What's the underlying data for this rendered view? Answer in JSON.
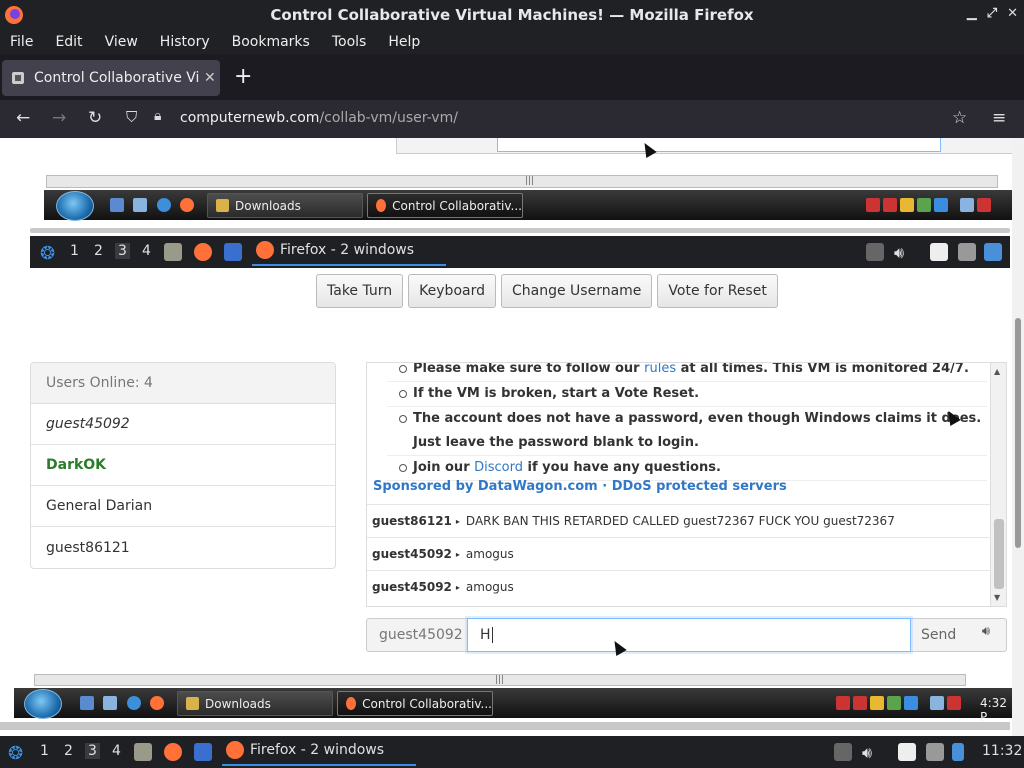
{
  "browser": {
    "window_title": "Control Collaborative Virtual Machines! — Mozilla Firefox",
    "menu": [
      "File",
      "Edit",
      "View",
      "History",
      "Bookmarks",
      "Tools",
      "Help"
    ],
    "tab_title": "Control Collaborative Virtual Machines!",
    "url_domain": "computernewb.com",
    "url_path": "/collab-vm/user-vm/"
  },
  "vm_taskbar": {
    "downloads": "Downloads",
    "firefox_task": "Control Collaborativ...",
    "clock": "4:32 P"
  },
  "guest_panel": {
    "workspaces": [
      "1",
      "2",
      "3",
      "4"
    ],
    "firefox_windows": "Firefox - 2 windows"
  },
  "controls": {
    "take_turn": "Take Turn",
    "keyboard": "Keyboard",
    "change_username": "Change Username",
    "vote_reset": "Vote for Reset"
  },
  "users": {
    "header": "Users Online: 4",
    "list": [
      "guest45092",
      "DarkOK",
      "General Darian",
      "guest86121"
    ]
  },
  "chat": {
    "rules": [
      {
        "pre": "Please make sure to follow our ",
        "link": "rules",
        "post": " at all times. This VM is monitored 24/7."
      },
      {
        "pre": "If the VM is broken, start a Vote Reset.",
        "link": "",
        "post": ""
      },
      {
        "pre": "The account does not have a password, even though Windows claims it does. Just leave the password blank to login.",
        "link": "",
        "post": ""
      },
      {
        "pre": "Join our ",
        "link": "Discord",
        "post": " if you have any questions."
      }
    ],
    "sponsor": "Sponsored by DataWagon.com · DDoS protected servers",
    "messages": [
      {
        "user": "guest86121",
        "text": "DARK BAN THIS RETARDED CALLED guest72367 FUCK YOU guest72367"
      },
      {
        "user": "guest45092",
        "text": "amogus"
      },
      {
        "user": "guest45092",
        "text": "amogus"
      }
    ]
  },
  "send": {
    "username": "guest45092",
    "input_value": "H",
    "send_label": "Send"
  },
  "host_panel": {
    "clock": "11:32"
  },
  "colors": {
    "link": "#3178c6",
    "admin": "#2a7d2a",
    "focus": "#80bdff"
  }
}
